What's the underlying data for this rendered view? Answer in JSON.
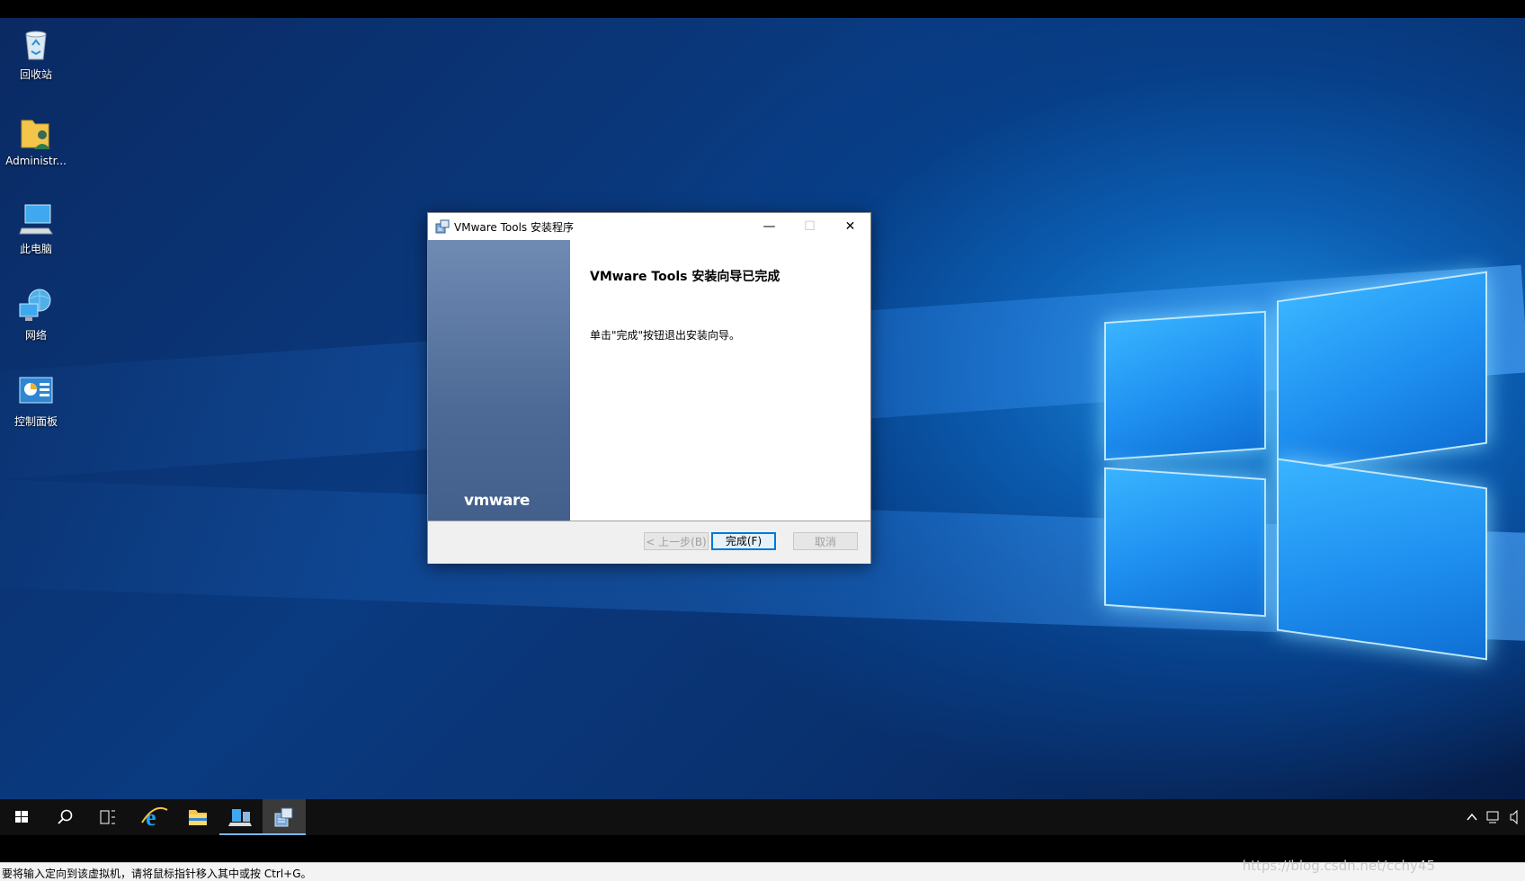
{
  "desktop": {
    "icons": [
      {
        "label": "回收站",
        "icon": "recycle-bin-icon"
      },
      {
        "label": "Administr...",
        "icon": "user-folder-icon"
      },
      {
        "label": "此电脑",
        "icon": "this-pc-icon"
      },
      {
        "label": "网络",
        "icon": "network-icon"
      },
      {
        "label": "控制面板",
        "icon": "control-panel-icon"
      }
    ]
  },
  "dialog": {
    "title": "VMware Tools 安装程序",
    "heading": "VMware Tools 安装向导已完成",
    "description": "单击\"完成\"按钮退出安装向导。",
    "brand": "vmware",
    "buttons": {
      "back": "< 上一步(B)",
      "finish": "完成(F)",
      "cancel": "取消"
    },
    "window_controls": {
      "minimize": "—",
      "maximize": "☐",
      "close": "✕"
    }
  },
  "taskbar": {
    "items": [
      "start-icon",
      "search-icon",
      "task-view-icon",
      "internet-explorer-icon",
      "file-explorer-icon",
      "server-manager-icon",
      "vmware-tools-setup-icon"
    ]
  },
  "statusbar": {
    "message": "要将输入定向到该虚拟机，请将鼠标指针移入其中或按 Ctrl+G。",
    "watermark": "https://blog.csdn.net/cchy45"
  },
  "colors": {
    "accent": "#0078d7",
    "sidepanel": "#4d6a96",
    "taskbar": "#101010"
  }
}
